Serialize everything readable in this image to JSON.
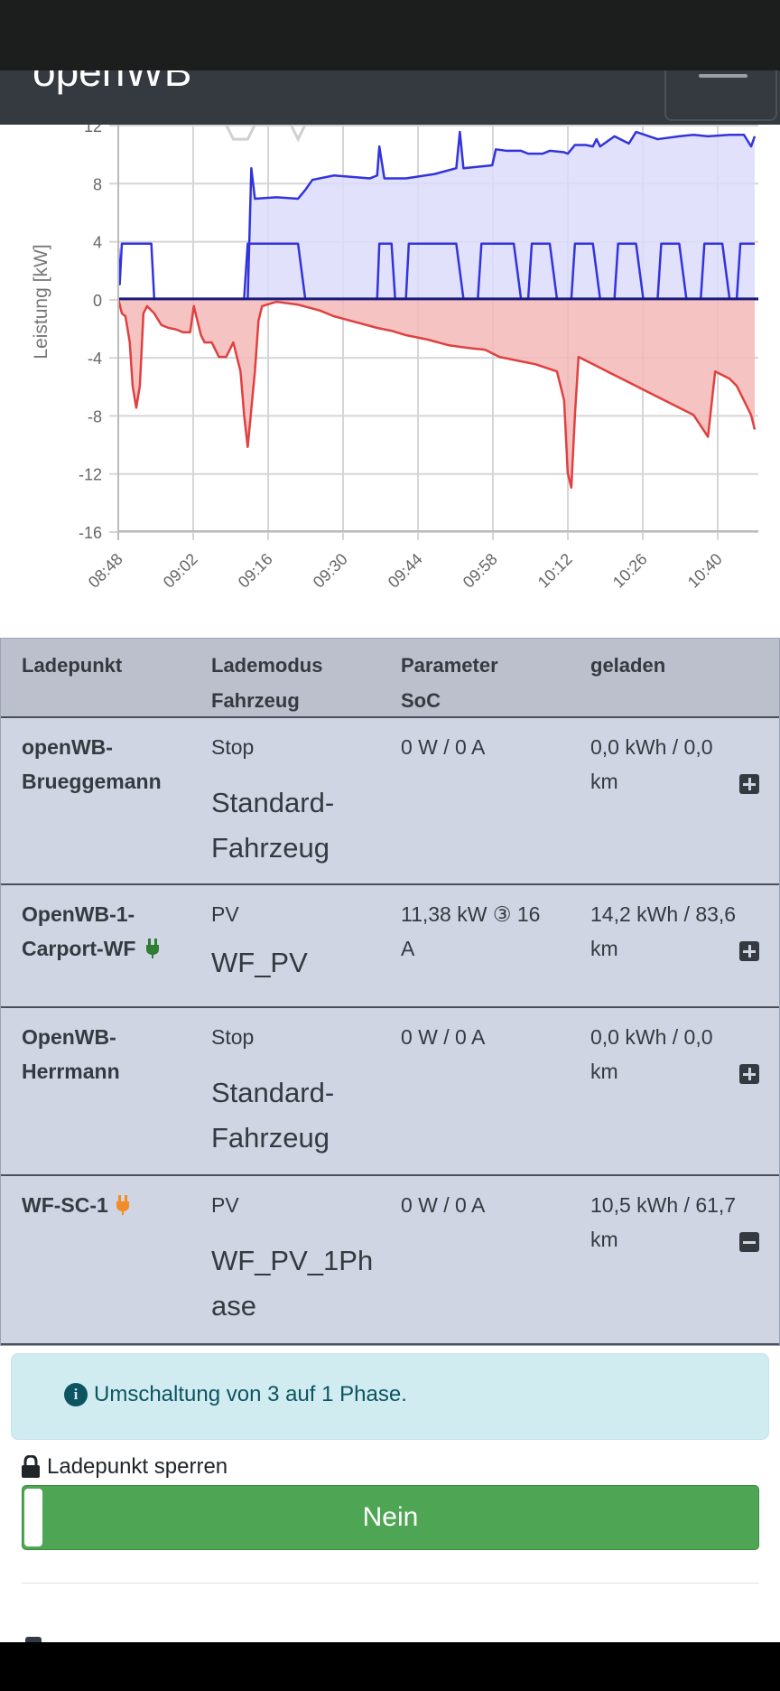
{
  "app": {
    "brand": "openWB"
  },
  "chart_data": {
    "type": "area",
    "ylabel": "Leistung [kW]",
    "y_ticks": [
      "12",
      "8",
      "4",
      "0",
      "-4",
      "-8",
      "-12",
      "-16"
    ],
    "x_ticks": [
      "08:48",
      "09:02",
      "09:16",
      "09:30",
      "09:44",
      "09:58",
      "10:12",
      "10:26",
      "10:40"
    ],
    "ylim": [
      -16,
      12
    ],
    "grid": true,
    "colors": {
      "charge": "#3333dd",
      "charge_fill": "#dcdcfa",
      "grid_power": "#e04040",
      "grid_fill": "#f4b8b8",
      "baseline": "#1a1a7a",
      "house": "#d0d0d0"
    },
    "series": [
      {
        "values": [
          [
            0,
            3.5
          ],
          [
            0.2,
            1
          ],
          [
            0.5,
            3.8
          ],
          [
            1,
            3.8
          ],
          [
            2,
            3.8
          ],
          [
            3,
            3.8
          ],
          [
            4,
            3.8
          ],
          [
            4.6,
            3.8
          ],
          [
            5,
            0
          ],
          [
            10,
            0
          ],
          [
            14,
            0
          ],
          [
            17.5,
            0
          ],
          [
            18,
            3.8
          ],
          [
            21,
            3.8
          ],
          [
            24,
            3.8
          ],
          [
            25,
            3.8
          ],
          [
            26,
            0
          ],
          [
            36,
            0
          ],
          [
            36.3,
            3.8
          ],
          [
            38,
            3.8
          ],
          [
            38.5,
            0
          ],
          [
            40,
            0
          ],
          [
            40.4,
            3.8
          ],
          [
            47,
            3.8
          ],
          [
            48,
            0
          ],
          [
            50,
            0
          ],
          [
            50.5,
            3.8
          ],
          [
            55,
            3.8
          ],
          [
            56,
            0
          ],
          [
            57,
            0
          ],
          [
            57.5,
            3.8
          ],
          [
            60,
            3.8
          ],
          [
            61,
            0
          ],
          [
            63,
            0
          ],
          [
            63.5,
            3.8
          ],
          [
            66,
            3.8
          ],
          [
            67,
            0
          ],
          [
            69,
            0
          ],
          [
            69.5,
            3.8
          ],
          [
            72,
            3.8
          ],
          [
            73,
            0
          ],
          [
            75,
            0
          ],
          [
            75.5,
            3.8
          ],
          [
            78,
            3.8
          ],
          [
            79,
            0
          ],
          [
            81,
            0
          ],
          [
            81.5,
            3.8
          ],
          [
            84,
            3.8
          ],
          [
            85,
            0
          ],
          [
            86,
            0
          ],
          [
            86.5,
            3.8
          ],
          [
            88,
            3.8
          ],
          [
            88.5,
            3.8
          ]
        ]
      },
      {
        "values": [
          [
            18,
            0
          ],
          [
            18.5,
            9
          ],
          [
            19,
            6.9
          ],
          [
            22,
            7
          ],
          [
            25,
            6.9
          ],
          [
            26,
            7.5
          ],
          [
            27,
            8.2
          ],
          [
            30,
            8.5
          ],
          [
            35,
            8.3
          ],
          [
            36,
            8.5
          ],
          [
            36.3,
            10.5
          ],
          [
            37,
            8.3
          ],
          [
            40,
            8.3
          ],
          [
            44,
            8.6
          ],
          [
            47,
            9
          ],
          [
            47.5,
            11.5
          ],
          [
            48,
            9
          ],
          [
            52,
            9.2
          ],
          [
            52.5,
            10.3
          ],
          [
            54,
            10.2
          ],
          [
            56,
            10.2
          ],
          [
            57,
            10
          ],
          [
            59,
            10
          ],
          [
            60,
            10.2
          ],
          [
            62,
            10.1
          ],
          [
            62.5,
            10
          ],
          [
            63.5,
            10.6
          ],
          [
            65,
            10.6
          ],
          [
            66,
            10.5
          ],
          [
            66.5,
            11
          ],
          [
            67,
            10.5
          ],
          [
            69,
            11.2
          ],
          [
            71,
            10.7
          ],
          [
            72,
            11.5
          ],
          [
            75,
            11
          ],
          [
            78,
            11.2
          ],
          [
            80,
            11.3
          ],
          [
            82,
            11.2
          ],
          [
            85,
            11.3
          ],
          [
            87,
            11.3
          ],
          [
            88,
            10.5
          ],
          [
            88.5,
            11.2
          ]
        ]
      },
      {
        "values": [
          [
            0,
            0
          ],
          [
            0.5,
            -1
          ],
          [
            1,
            -1.2
          ],
          [
            1.6,
            -3
          ],
          [
            2,
            -6
          ],
          [
            2.5,
            -7.5
          ],
          [
            3,
            -6
          ],
          [
            3.5,
            -1
          ],
          [
            4,
            -0.5
          ],
          [
            5,
            -1
          ],
          [
            6,
            -1.8
          ],
          [
            7,
            -2
          ],
          [
            8,
            -2.1
          ],
          [
            9,
            -2.3
          ],
          [
            10,
            -2.3
          ],
          [
            10.5,
            -0.5
          ],
          [
            11,
            -1.5
          ],
          [
            11.5,
            -2.5
          ],
          [
            12,
            -3
          ],
          [
            13,
            -3
          ],
          [
            14,
            -4
          ],
          [
            15,
            -4
          ],
          [
            16,
            -3
          ],
          [
            17,
            -5
          ],
          [
            17.5,
            -8
          ],
          [
            18,
            -10.2
          ],
          [
            19,
            -5
          ],
          [
            19.5,
            -1.5
          ],
          [
            20,
            -0.5
          ],
          [
            22,
            -0.2
          ],
          [
            25,
            -0.4
          ],
          [
            28,
            -0.8
          ],
          [
            30,
            -1.2
          ],
          [
            33,
            -1.6
          ],
          [
            36,
            -2
          ],
          [
            38,
            -2.2
          ],
          [
            40,
            -2.5
          ],
          [
            43,
            -2.8
          ],
          [
            46,
            -3.2
          ],
          [
            49,
            -3.4
          ],
          [
            51,
            -3.5
          ],
          [
            53,
            -4
          ],
          [
            56,
            -4.3
          ],
          [
            58,
            -4.5
          ],
          [
            61,
            -5
          ],
          [
            62,
            -7
          ],
          [
            62.5,
            -12
          ],
          [
            63,
            -13
          ],
          [
            63.5,
            -8
          ],
          [
            64,
            -4
          ],
          [
            66,
            -4.5
          ],
          [
            68,
            -5
          ],
          [
            70,
            -5.5
          ],
          [
            72,
            -6
          ],
          [
            74,
            -6.5
          ],
          [
            76,
            -7
          ],
          [
            78,
            -7.5
          ],
          [
            80,
            -8
          ],
          [
            82,
            -9.5
          ],
          [
            83,
            -5
          ],
          [
            85,
            -5.5
          ],
          [
            86,
            -6
          ],
          [
            87,
            -7
          ],
          [
            88,
            -8
          ],
          [
            88.5,
            -9
          ]
        ]
      }
    ]
  },
  "table": {
    "headers": {
      "col1": "Ladepunkt",
      "col2a": "Lademodus",
      "col2b": "Fahrzeug",
      "col3a": "Parameter",
      "col3b": "SoC",
      "col4": "geladen"
    },
    "rows": [
      {
        "name_a": "openWB-",
        "name_b": "Brueggemann",
        "mode": "Stop",
        "vehicle_a": "Standard-",
        "vehicle_b": "Fahrzeug",
        "param_a": "0 W / 0 A",
        "param_b": "",
        "charged_a": "0,0 kWh / 0,0",
        "charged_b": "km",
        "toggle_icon": "plus-square-icon",
        "plug_icon": ""
      },
      {
        "name_a": "OpenWB-1-",
        "name_b": "Carport-WF",
        "mode": "PV",
        "vehicle_a": "WF_PV",
        "vehicle_b": "",
        "param_a": "11,38 kW ③ 16",
        "param_b": "A",
        "charged_a": "14,2 kWh / 83,6",
        "charged_b": "km",
        "toggle_icon": "plus-square-icon",
        "plug_icon": "plug-icon",
        "plug_color": "#28a745"
      },
      {
        "name_a": "OpenWB-",
        "name_b": "Herrmann",
        "mode": "Stop",
        "vehicle_a": "Standard-",
        "vehicle_b": "Fahrzeug",
        "param_a": "0 W / 0 A",
        "param_b": "",
        "charged_a": "0,0 kWh / 0,0",
        "charged_b": "km",
        "toggle_icon": "plus-square-icon",
        "plug_icon": ""
      },
      {
        "name_a": "WF-SC-1",
        "name_b": "",
        "mode": "PV",
        "vehicle_a": "WF_PV_1Ph",
        "vehicle_b": "ase",
        "param_a": "0 W / 0 A",
        "param_b": "",
        "charged_a": "10,5 kWh / 61,7",
        "charged_b": "km",
        "toggle_icon": "minus-square-icon",
        "plug_icon": "plug-icon",
        "plug_color": "#fd7e14"
      }
    ]
  },
  "alert": {
    "icon": "info-circle-icon",
    "text": "Umschaltung von 3 auf 1 Phase."
  },
  "lock": {
    "icon": "lock-icon",
    "label": "Ladepunkt sperren",
    "value": "Nein",
    "color": "#4ea654"
  }
}
